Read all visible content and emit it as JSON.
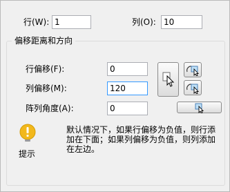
{
  "rows": {
    "label": "行(W):",
    "value": "1"
  },
  "cols": {
    "label": "列(O):",
    "value": "10"
  },
  "group": {
    "title": "偏移距离和方向"
  },
  "row_offset": {
    "label": "行偏移(F):",
    "value": "0"
  },
  "col_offset": {
    "label": "列偏移(M):",
    "value": "120"
  },
  "array_angle": {
    "label": "阵列角度(A):",
    "value": "0"
  },
  "tip": {
    "label": "提示",
    "text": "默认情况下，如果行偏移为负值，则行添加在下面；如果列偏移为负值，则列添加在左边。"
  },
  "icons": {
    "pick_both": "pick-both-offsets-icon",
    "pick_row": "pick-row-offset-icon",
    "pick_col": "pick-column-offset-icon",
    "pick_angle": "pick-angle-icon",
    "tip": "lightbulb-icon"
  }
}
